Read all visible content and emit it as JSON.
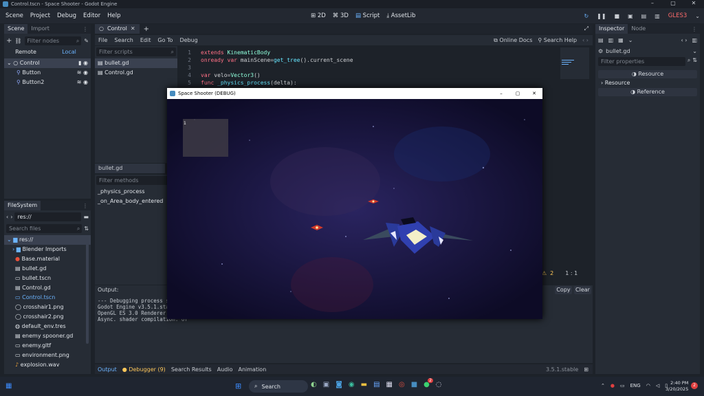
{
  "window_title": "Control.tscn - Space Shooter - Godot Engine",
  "menu": [
    "Scene",
    "Project",
    "Debug",
    "Editor",
    "Help"
  ],
  "modes": [
    "2D",
    "3D",
    "Script",
    "AssetLib"
  ],
  "renderer": "GLES3",
  "scene_dock": {
    "tabs": [
      "Scene",
      "Import"
    ],
    "filter_placeholder": "Filter nodes",
    "remote": "Remote",
    "local": "Local",
    "nodes": [
      "Control",
      "Button",
      "Button2"
    ]
  },
  "filesystem": {
    "tab": "FileSystem",
    "path": "res://",
    "search_placeholder": "Search files",
    "items": [
      "res://",
      "Blender Imports",
      "Base.material",
      "bullet.gd",
      "bullet.tscn",
      "Control.gd",
      "Control.tscn",
      "crosshair1.png",
      "crosshair2.png",
      "default_env.tres",
      "enemy spooner.gd",
      "enemy.gltf",
      "environment.png",
      "explosion.wav"
    ]
  },
  "editor_tabs": {
    "current": "Control"
  },
  "script_menu": [
    "File",
    "Search",
    "Edit",
    "Go To",
    "Debug"
  ],
  "script_links": {
    "docs": "Online Docs",
    "help": "Search Help"
  },
  "script_list": {
    "filter_placeholder": "Filter scripts",
    "scripts": [
      "bullet.gd",
      "Control.gd"
    ],
    "current": "bullet.gd",
    "methods_placeholder": "Filter methods",
    "methods": [
      "_physics_process",
      "_on_Area_body_entered"
    ]
  },
  "code": {
    "line_numbers": [
      "1",
      "2",
      "3",
      "4",
      "5"
    ],
    "l1_kw": "extends",
    "l1_ty": "KinematicBody",
    "l2_kw": "onready var",
    "l2_tx": " mainScene=",
    "l2_fn": "get_tree",
    "l2_tx2": "().current_scene",
    "l4_kw": "var",
    "l4_tx": " velo=",
    "l4_ty": "Vector3",
    "l4_tx2": "()",
    "l5_kw": "func",
    "l5_fn": " _physics_process",
    "l5_tx": "(delta):"
  },
  "status": {
    "warnings": "2",
    "position": "1 :  1"
  },
  "output": {
    "label": "Output:",
    "copy": "Copy",
    "clear": "Clear",
    "lines": [
      "--- Debugging process st",
      "Godot Engine v3.5.1.stab",
      "OpenGL ES 3.0 Renderer:",
      "Async. shader compilation: of"
    ]
  },
  "bottom_tabs": [
    "Output",
    "Debugger (9)",
    "Search Results",
    "Audio",
    "Animation"
  ],
  "version": "3.5.1.stable",
  "inspector": {
    "tabs": [
      "Inspector",
      "Node"
    ],
    "file": "bullet.gd",
    "filter_placeholder": "Filter properties",
    "resource_header": "Resource",
    "resource_row": "Resource",
    "reference": "Reference"
  },
  "game_window": {
    "title": "Space Shooter (DEBUG)",
    "hud_value": "1"
  },
  "taskbar": {
    "search": "Search",
    "lang": "ENG",
    "time": "2:40 PM",
    "date": "3/20/2025",
    "badge": "2",
    "notif": "2"
  }
}
